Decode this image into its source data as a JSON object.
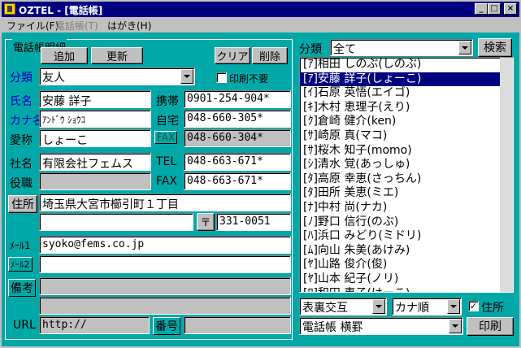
{
  "window": {
    "title": "OZTEL - [電話帳]"
  },
  "menu": [
    {
      "label": "ファイル(F)",
      "enabled": true
    },
    {
      "label": "電話帳(T)",
      "enabled": false
    },
    {
      "label": "はがき(H)",
      "enabled": true
    }
  ],
  "detail": {
    "group_title": "電話帳明細",
    "buttons": {
      "add": "追加",
      "update": "更新",
      "clear": "クリア",
      "delete": "削除"
    },
    "category_label": "分類",
    "category_value": "友人",
    "no_print_label": "印刷不要",
    "no_print_checked": false,
    "name_label": "氏名",
    "name_value": "安藤 詳子",
    "kana_label": "カナ名",
    "kana_value": "ｱﾝﾄﾞｳ ｼｮｳｺ",
    "nickname_label": "愛称",
    "nickname_value": "しょーこ",
    "mobile_label": "携帯",
    "mobile_value": "0901-254-904*",
    "home_label": "自宅",
    "home_value": "048-660-305*",
    "fax_label": "FAX",
    "fax_value": "048-660-304*",
    "company_label": "社名",
    "company_value": "有限会社フェムス",
    "position_label": "役職",
    "position_value": "",
    "company_tel_label": "TEL",
    "company_tel_value": "048-663-671*",
    "company_fax_label": "FAX",
    "company_fax_value": "048-663-671*",
    "address_button": "住所",
    "address_value": "埼玉県大宮市櫛引町１丁目",
    "address2_value": "",
    "zip_symbol": "〒",
    "zip_value": "331-0051",
    "mail1_label": "ﾒｰﾙ1",
    "mail1_value": "syoko@fems.co.jp",
    "mail2_label": "ﾒｰﾙ2",
    "mail2_value": "",
    "note_label": "備考",
    "url_label": "URL",
    "url_value": "http://",
    "number_label": "番号",
    "number_value": ""
  },
  "search": {
    "category_label": "分類",
    "category_value": "全て",
    "search_button": "検索"
  },
  "contacts": [
    "[ｱ]相田 しのぶ(しのぶ)",
    "[ｱ]安藤 詳子(しょーこ)",
    "[ｲ]石原 英悟(エイゴ)",
    "[ｷ]木村 恵理子(えり)",
    "[ｸ]倉崎 健介(ken)",
    "[ｻ]崎原 真(マコ)",
    "[ｻ]桜木 知子(momo)",
    "[ｼ]清水 覚(あっしゅ)",
    "[ﾀ]高原 幸恵(さっちん)",
    "[ﾀ]田所 美恵(ミエ)",
    "[ﾅ]中村 尚(ナカ)",
    "[ﾉ]野口 信行(のぶ)",
    "[ﾊ]浜口 みどり(ミドリ)",
    "[ﾑ]向山 朱美(あけみ)",
    "[ﾔ]山路 俊介(俊)",
    "[ﾔ]山本 紀子(ノリ)",
    "[ﾜ]和田 恵子(けーこ)"
  ],
  "selected_index": 1,
  "footer": {
    "print_side_value": "表裏交互",
    "sort_value": "カナ順",
    "address_check_label": "住所",
    "address_checked": true,
    "format_value": "電話帳 横罫",
    "print_button": "印刷"
  }
}
